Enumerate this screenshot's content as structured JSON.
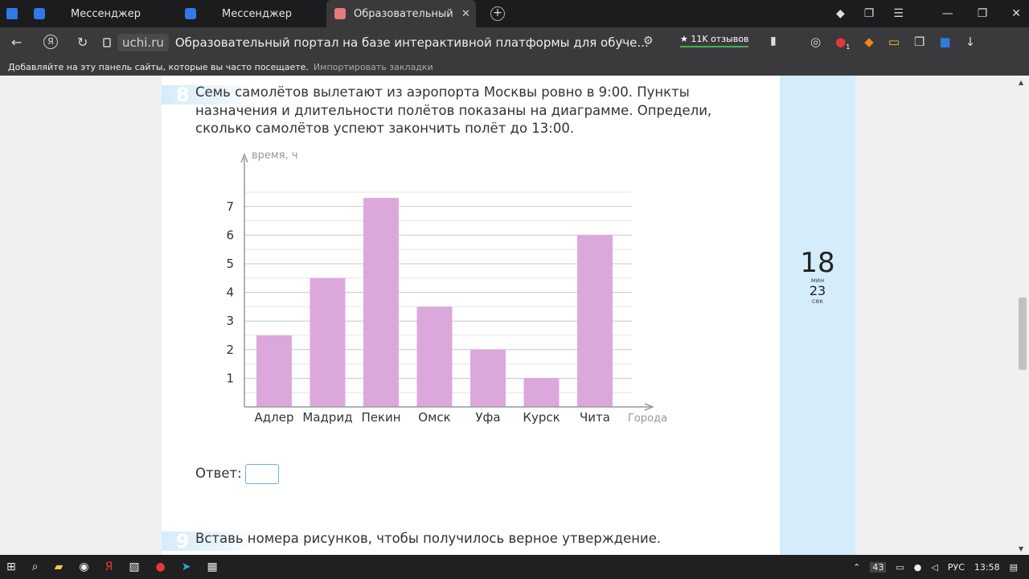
{
  "tabs": [
    {
      "title": "Мессенджер"
    },
    {
      "title": "Мессенджер"
    },
    {
      "title": "Образовательный порт"
    }
  ],
  "addressbar": {
    "domain": "uchi.ru",
    "page_title": "Образовательный портал на базе интерактивной платформы для обуче...",
    "reviews": "★ 11K отзывов",
    "ext_badge": "1"
  },
  "bookmarks": {
    "hint": "Добавляйте на эту панель сайты, которые вы часто посещаете.",
    "import_link": "Импортировать закладки"
  },
  "question8": {
    "number": "8",
    "text": "Семь самолётов вылетают из аэропорта Москвы ровно в 9:00. Пункты назначения и длительности полётов показаны на диаграмме. Определи, сколько самолётов успеют закончить полёт до 13:00.",
    "answer_label": "Ответ:",
    "answer_value": ""
  },
  "question9": {
    "number": "9",
    "text": "Вставь номера рисунков, чтобы получилось верное утверждение."
  },
  "timer": {
    "minutes": "18",
    "min_label": "мин",
    "seconds": "23",
    "sec_label": "сек"
  },
  "chart_data": {
    "type": "bar",
    "categories": [
      "Адлер",
      "Мадрид",
      "Пекин",
      "Омск",
      "Уфа",
      "Курск",
      "Чита"
    ],
    "values": [
      2.5,
      4.5,
      7.3,
      3.5,
      2,
      1,
      6
    ],
    "ylabel": "время, ч",
    "xlabel": "Города",
    "yticks": [
      1,
      2,
      3,
      4,
      5,
      6,
      7
    ],
    "ylim": [
      0,
      7.5
    ],
    "grid": true,
    "bar_color": "#dca8dc"
  },
  "taskbar": {
    "lang": "РУС",
    "time": "13:58",
    "badge": "43"
  },
  "colors": {
    "accent": "#2f7ae5",
    "panel": "#d5ecfb"
  }
}
